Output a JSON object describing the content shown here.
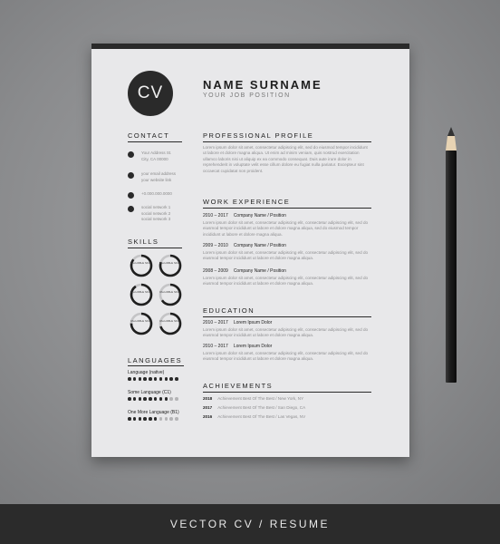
{
  "header": {
    "monogram": "CV",
    "name": "NAME SURNAME",
    "job_position": "YOUR JOB POSITION"
  },
  "sections": {
    "contact": "CONTACT",
    "skills": "SKILLS",
    "languages": "LANGUAGES",
    "profile": "PROFESSIONAL PROFILE",
    "experience": "WORK EXPERIENCE",
    "education": "EDUCATION",
    "achievements": "ACHIEVEMENTS"
  },
  "contact": [
    {
      "icon": "location-icon",
      "lines": [
        "Your Address St.",
        "City, CA 00000"
      ]
    },
    {
      "icon": "email-icon",
      "lines": [
        "your email address",
        "your website link"
      ]
    },
    {
      "icon": "phone-icon",
      "lines": [
        "+0.000.000.0000"
      ]
    },
    {
      "icon": "social-icon",
      "lines": [
        "social network 1",
        "social network 2",
        "social network 3"
      ]
    }
  ],
  "skills": [
    {
      "label": "VALUABLE SKILL",
      "level": 0.85
    },
    {
      "label": "VALUABLE SKILL",
      "level": 0.8
    },
    {
      "label": "VALUABLE SKILL",
      "level": 0.9
    },
    {
      "label": "VALUABLE SKILL",
      "level": 0.65
    },
    {
      "label": "VALUABLE SKILL",
      "level": 0.75
    },
    {
      "label": "VALUABLE SKILL",
      "level": 0.7
    }
  ],
  "languages": [
    {
      "name": "Language (native)",
      "filled": 10,
      "total": 10
    },
    {
      "name": "Some Language (C1)",
      "filled": 8,
      "total": 10
    },
    {
      "name": "One More Language (B1)",
      "filled": 6,
      "total": 10
    }
  ],
  "profile_text": "Lorem ipsum dolor sit amet, consectetur adipiscing elit, sed do eiusmod tempor incididunt ut labore et dolore magna aliqua. Ut enim ad minim veniam, quis nostrud exercitation ullamco laboris nisi ut aliquip ex ea commodo consequat. Duis aute irure dolor in reprehenderit in voluptate velit esse cillum dolore eu fugiat nulla pariatur. Excepteur sint occaecat cupidatat non proident.",
  "experience": [
    {
      "years": "2010 – 2017",
      "title": "Company Name / Position",
      "desc": "Lorem ipsum dolor sit amet, consectetur adipiscing elit, consectetur adipiscing elit, sed do eiusmod tempor incididunt ut labore et dolore magna aliqua, sed do eiusmod tempor incididunt ut labore et dolore magna aliqua."
    },
    {
      "years": "2009 – 2010",
      "title": "Company Name / Position",
      "desc": "Lorem ipsum dolor sit amet, consectetur adipiscing elit, consectetur adipiscing elit, sed do eiusmod tempor incididunt ut labore et dolore magna aliqua."
    },
    {
      "years": "2008 – 2009",
      "title": "Company Name / Position",
      "desc": "Lorem ipsum dolor sit amet, consectetur adipiscing elit, consectetur adipiscing elit, sed do eiusmod tempor incididunt ut labore et dolore magna aliqua."
    }
  ],
  "education": [
    {
      "years": "2010 – 2017",
      "title": "Lorem Ipsum Dolor",
      "desc": "Lorem ipsum dolor sit amet, consectetur adipiscing elit, consectetur adipiscing elit, sed do eiusmod tempor incididunt ut labore et dolore magna aliqua."
    },
    {
      "years": "2010 – 2017",
      "title": "Lorem Ipsum Dolor",
      "desc": "Lorem ipsum dolor sit amet, consectetur adipiscing elit, consectetur adipiscing elit, sed do eiusmod tempor incididunt ut labore et dolore magna aliqua."
    }
  ],
  "achievements": [
    {
      "year": "2018",
      "text": "Achievement Best Of The Best / New York, NY"
    },
    {
      "year": "2017",
      "text": "Achievement Best Of The Best / San Diego, CA"
    },
    {
      "year": "2016",
      "text": "Achievement Best Of The Best / Las Vegas, NV"
    }
  ],
  "footer": "VECTOR CV / RESUME",
  "colors": {
    "accent": "#2a2a2a",
    "paper": "#e8e8ea",
    "background": "#8c8d8f",
    "footer": "#2b2b2b"
  }
}
